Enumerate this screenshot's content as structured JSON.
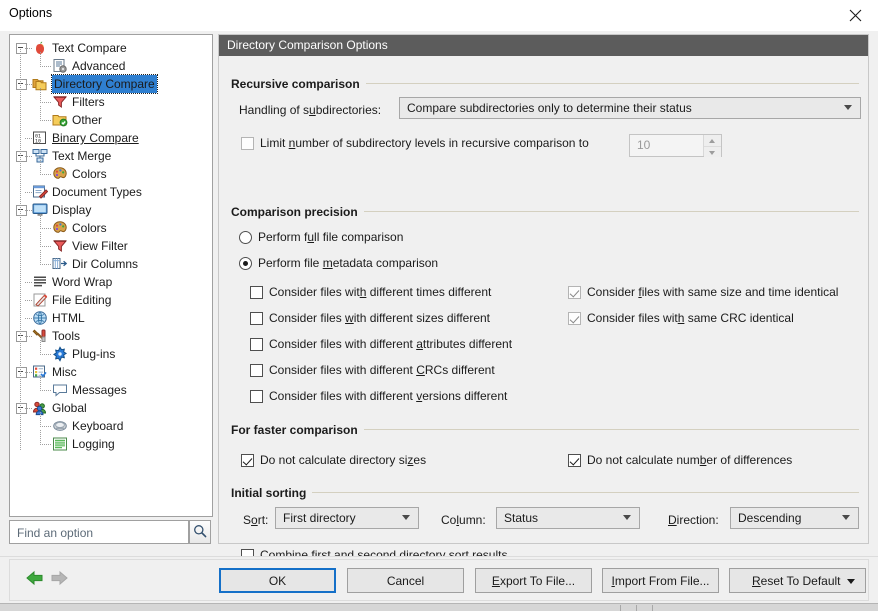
{
  "window": {
    "title": "Options",
    "close_icon": "close-icon"
  },
  "sidebar": {
    "search": {
      "placeholder": "Find an option",
      "value": "",
      "button_icon": "search-icon"
    },
    "items": [
      {
        "label": "Text Compare",
        "icon": "apple-icon",
        "level": 0,
        "expandable": true,
        "style": "normal"
      },
      {
        "label": "Advanced",
        "icon": "advanced-icon",
        "level": 1,
        "expandable": false,
        "style": "normal"
      },
      {
        "label": "Directory Compare",
        "icon": "folders-icon",
        "level": 0,
        "expandable": true,
        "style": "selected"
      },
      {
        "label": "Filters",
        "icon": "filter-icon",
        "level": 1,
        "expandable": false,
        "style": "normal"
      },
      {
        "label": "Other",
        "icon": "folder-check-icon",
        "level": 1,
        "expandable": false,
        "style": "normal"
      },
      {
        "label": "Binary Compare",
        "icon": "binary-icon",
        "level": 0,
        "expandable": false,
        "style": "link"
      },
      {
        "label": "Text Merge",
        "icon": "merge-icon",
        "level": 0,
        "expandable": true,
        "style": "normal"
      },
      {
        "label": "Colors",
        "icon": "palette-icon",
        "level": 1,
        "expandable": false,
        "style": "normal"
      },
      {
        "label": "Document Types",
        "icon": "document-icon",
        "level": 0,
        "expandable": false,
        "style": "normal"
      },
      {
        "label": "Display",
        "icon": "monitor-icon",
        "level": 0,
        "expandable": true,
        "style": "normal"
      },
      {
        "label": "Colors",
        "icon": "palette-icon",
        "level": 1,
        "expandable": false,
        "style": "normal"
      },
      {
        "label": "View Filter",
        "icon": "filter-icon",
        "level": 1,
        "expandable": false,
        "style": "normal"
      },
      {
        "label": "Dir Columns",
        "icon": "columns-icon",
        "level": 1,
        "expandable": false,
        "style": "normal"
      },
      {
        "label": "Word Wrap",
        "icon": "wordwrap-icon",
        "level": 0,
        "expandable": false,
        "style": "normal"
      },
      {
        "label": "File Editing",
        "icon": "pencil-icon",
        "level": 0,
        "expandable": false,
        "style": "normal"
      },
      {
        "label": "HTML",
        "icon": "globe-icon",
        "level": 0,
        "expandable": false,
        "style": "normal"
      },
      {
        "label": "Tools",
        "icon": "tools-icon",
        "level": 0,
        "expandable": true,
        "style": "normal"
      },
      {
        "label": "Plug-ins",
        "icon": "plugin-icon",
        "level": 1,
        "expandable": false,
        "style": "normal"
      },
      {
        "label": "Misc",
        "icon": "misc-icon",
        "level": 0,
        "expandable": true,
        "style": "normal"
      },
      {
        "label": "Messages",
        "icon": "message-icon",
        "level": 1,
        "expandable": false,
        "style": "normal"
      },
      {
        "label": "Global",
        "icon": "users-icon",
        "level": 0,
        "expandable": true,
        "style": "normal"
      },
      {
        "label": "Keyboard",
        "icon": "keyboard-icon",
        "level": 1,
        "expandable": false,
        "style": "normal"
      },
      {
        "label": "Logging",
        "icon": "logging-icon",
        "level": 1,
        "expandable": false,
        "style": "normal"
      }
    ]
  },
  "panel": {
    "header": "Directory Comparison Options",
    "recursive": {
      "group_label": "Recursive comparison",
      "handling_label": "Handling of subdirectories:",
      "handling_value": "Compare subdirectories only to determine their status",
      "limit_label": "Limit number of subdirectory levels in recursive comparison to",
      "limit_checked": false,
      "limit_value": "10"
    },
    "precision": {
      "group_label": "Comparison precision",
      "radios": [
        {
          "label": "Perform full file comparison",
          "selected": false
        },
        {
          "label": "Perform file metadata comparison",
          "selected": true
        }
      ],
      "left_checks": [
        {
          "label": "Consider files with different times different",
          "checked": false
        },
        {
          "label": "Consider files with different sizes different",
          "checked": false
        },
        {
          "label": "Consider files with different attributes different",
          "checked": false
        },
        {
          "label": "Consider files with different CRCs different",
          "checked": false
        },
        {
          "label": "Consider files with different versions different",
          "checked": false
        }
      ],
      "right_checks": [
        {
          "label": "Consider files with same size and time identical",
          "checked": true
        },
        {
          "label": "Consider files with same CRC identical",
          "checked": true
        }
      ]
    },
    "faster": {
      "group_label": "For faster comparison",
      "checks": [
        {
          "label": "Do not calculate directory sizes",
          "checked": true
        },
        {
          "label": "Do not calculate number of differences",
          "checked": true
        }
      ]
    },
    "sorting": {
      "group_label": "Initial sorting",
      "sort_label": "Sort:",
      "sort_value": "First directory",
      "column_label": "Column:",
      "column_value": "Status",
      "direction_label": "Direction:",
      "direction_value": "Descending",
      "combine_label": "Combine first and second directory sort results",
      "combine_checked": false
    }
  },
  "footer": {
    "back_icon": "back-arrow-icon",
    "forward_icon": "forward-arrow-icon",
    "buttons": [
      {
        "label": "OK",
        "default": true
      },
      {
        "label": "Cancel",
        "default": false
      },
      {
        "label": "Export To File...",
        "default": false
      },
      {
        "label": "Import From File...",
        "default": false
      },
      {
        "label": "Reset To Default",
        "default": false,
        "split": true
      }
    ]
  },
  "colors": {
    "accent": "#1570c8",
    "selection": "#2f7fd0",
    "header_bar": "#5c5c5c",
    "window_bg": "#f0f0f0",
    "link": "#1a4fa0"
  }
}
